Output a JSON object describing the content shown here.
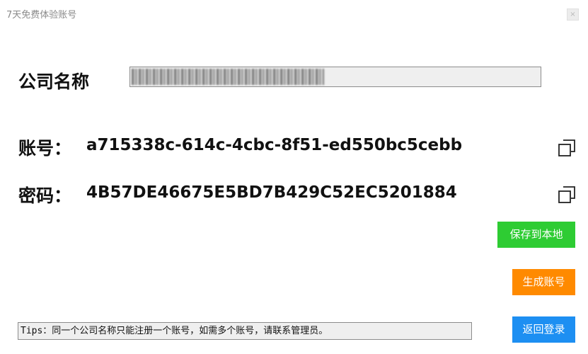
{
  "window": {
    "title": "7天免费体验账号",
    "close_label": "×"
  },
  "form": {
    "company_label": "公司名称",
    "account_label": "账号：",
    "account_value": "a715338c-614c-4cbc-8f51-ed550bc5cebb",
    "password_label": "密码：",
    "password_value": "4B57DE46675E5BD7B429C52EC5201884"
  },
  "buttons": {
    "save_label": "保存到本地",
    "generate_label": "生成账号",
    "back_label": "返回登录"
  },
  "tips": {
    "text": "Tips：同一个公司名称只能注册一个账号，如需多个账号，请联系管理员。"
  },
  "icons": {
    "copy": "copy-icon",
    "close": "close-icon"
  },
  "colors": {
    "save": "#2ecc33",
    "generate": "#ff8a00",
    "back": "#1d8ff2"
  }
}
